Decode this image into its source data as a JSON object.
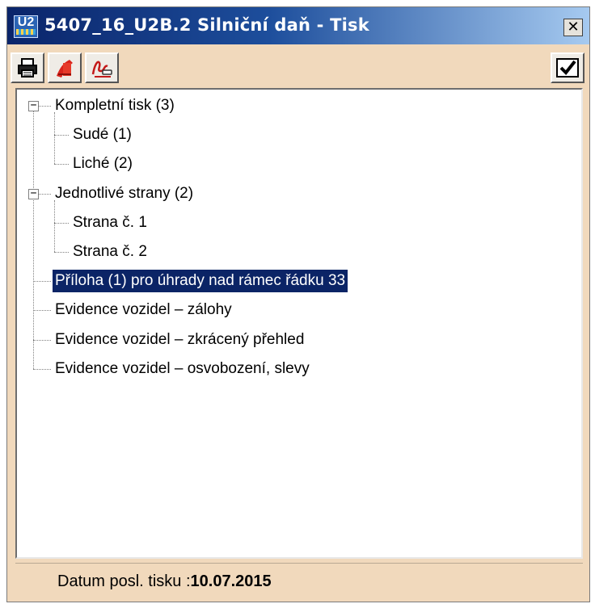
{
  "window": {
    "title": "5407_16_U2B.2 Silniční daň - Tisk",
    "app_icon_text": "U2",
    "close_symbol": "✕"
  },
  "toolbar": {
    "buttons": [
      {
        "name": "print-icon"
      },
      {
        "name": "pdf-export-icon"
      },
      {
        "name": "signature-icon"
      }
    ],
    "confirm": {
      "name": "checkmark-icon"
    }
  },
  "tree": {
    "nodes": [
      {
        "label": "Kompletní tisk (3)",
        "level": 0,
        "expandable": true,
        "expanded": true
      },
      {
        "label": "Sudé (1)",
        "level": 1
      },
      {
        "label": "Liché (2)",
        "level": 1
      },
      {
        "label": "Jednotlivé strany (2)",
        "level": 0,
        "expandable": true,
        "expanded": true
      },
      {
        "label": "Strana č. 1",
        "level": 1
      },
      {
        "label": "Strana č. 2",
        "level": 1
      },
      {
        "label": "Příloha (1) pro úhrady nad rámec řádku 33",
        "level": 0,
        "selected": true
      },
      {
        "label": "Evidence vozidel – zálohy",
        "level": 0
      },
      {
        "label": "Evidence vozidel – zkrácený přehled",
        "level": 0
      },
      {
        "label": "Evidence vozidel – osvobození, slevy",
        "level": 0
      }
    ]
  },
  "status": {
    "label": "Datum posl. tisku :",
    "value": "10.07.2015"
  },
  "colors": {
    "panel_bg": "#f1d9bc",
    "selection": "#0b2466",
    "titlebar_start": "#0a246a"
  }
}
